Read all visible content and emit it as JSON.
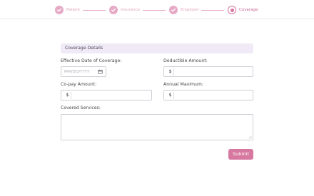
{
  "stepper": {
    "steps": [
      {
        "label": "Patient",
        "state": "complete"
      },
      {
        "label": "Insurance",
        "state": "complete"
      },
      {
        "label": "Employer",
        "state": "complete"
      },
      {
        "label": "Coverage",
        "state": "active"
      }
    ]
  },
  "form": {
    "section_title": "Coverage Details",
    "effective_date": {
      "label": "Effective Date of Coverage:",
      "placeholder": "MM/DD/YYYY",
      "value": ""
    },
    "deductible": {
      "label": "Deductible Amount:",
      "prefix": "$",
      "value": ""
    },
    "copay": {
      "label": "Co-pay Amount:",
      "prefix": "$",
      "value": ""
    },
    "annual_max": {
      "label": "Annual Maximum:",
      "prefix": "$",
      "value": ""
    },
    "covered_services": {
      "label": "Covered Services:",
      "value": ""
    },
    "submit_label": "Submit"
  },
  "colors": {
    "accent": "#d6789f",
    "step_complete": "#e6a9c5",
    "section_bg": "#efeaf6"
  },
  "icons": {
    "check": "check-icon",
    "calendar": "calendar-icon"
  }
}
